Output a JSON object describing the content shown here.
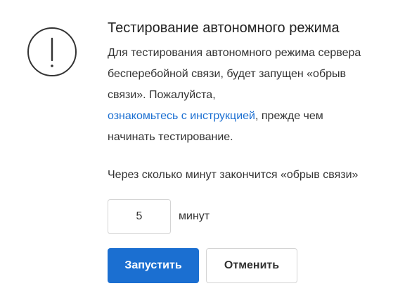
{
  "dialog": {
    "icon": "exclamation-circle-icon",
    "title": "Тестирование автономного режима",
    "description": {
      "line1": "Для тестирования автономного режима сервера",
      "line2": "бесперебойной связи, будет запущен «обрыв",
      "line3": "связи». Пожалуйста,",
      "link": "ознакомьтесь с инструкцией",
      "line4_after_link": ", прежде чем",
      "line5": "начинать тестирование."
    },
    "question": "Через сколько минут закончится «обрыв связи»",
    "minutes_value": "5",
    "minutes_unit": "минут",
    "start_label": "Запустить",
    "cancel_label": "Отменить"
  },
  "colors": {
    "accent": "#1b6fd1",
    "text": "#333333",
    "border": "#d4d4d4"
  }
}
